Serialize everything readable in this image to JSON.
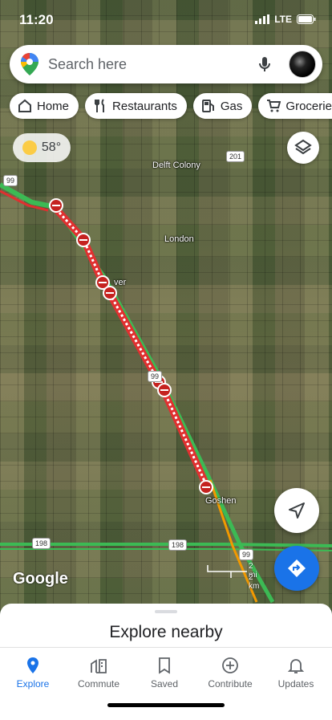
{
  "status": {
    "time": "11:20",
    "network": "LTE"
  },
  "search": {
    "placeholder": "Search here"
  },
  "chips": [
    {
      "label": "Home",
      "icon": "home-icon"
    },
    {
      "label": "Restaurants",
      "icon": "restaurant-icon"
    },
    {
      "label": "Gas",
      "icon": "gas-icon"
    },
    {
      "label": "Groceries",
      "icon": "cart-icon"
    }
  ],
  "weather": {
    "temp": "58°"
  },
  "map": {
    "labels": {
      "delft_colony": "Delft Colony",
      "london": "London",
      "traver": "ver",
      "goshen": "Goshen"
    },
    "shields": {
      "r99_top": "99",
      "r201": "201",
      "r99_mid": "99",
      "r198_left": "198",
      "r198_mid": "198",
      "r99_bottom": "99"
    },
    "scale": {
      "mi": "2 mi",
      "km": "2 km"
    },
    "logo": "Google",
    "colors": {
      "route": "#e03030",
      "traffic_green": "#3cba54",
      "traffic_orange": "#f29900"
    }
  },
  "sheet": {
    "title": "Explore nearby"
  },
  "tabs": [
    {
      "label": "Explore",
      "icon": "explore-pin-icon",
      "active": true
    },
    {
      "label": "Commute",
      "icon": "commute-icon",
      "active": false
    },
    {
      "label": "Saved",
      "icon": "bookmark-icon",
      "active": false
    },
    {
      "label": "Contribute",
      "icon": "add-circle-icon",
      "active": false
    },
    {
      "label": "Updates",
      "icon": "bell-icon",
      "active": false
    }
  ]
}
